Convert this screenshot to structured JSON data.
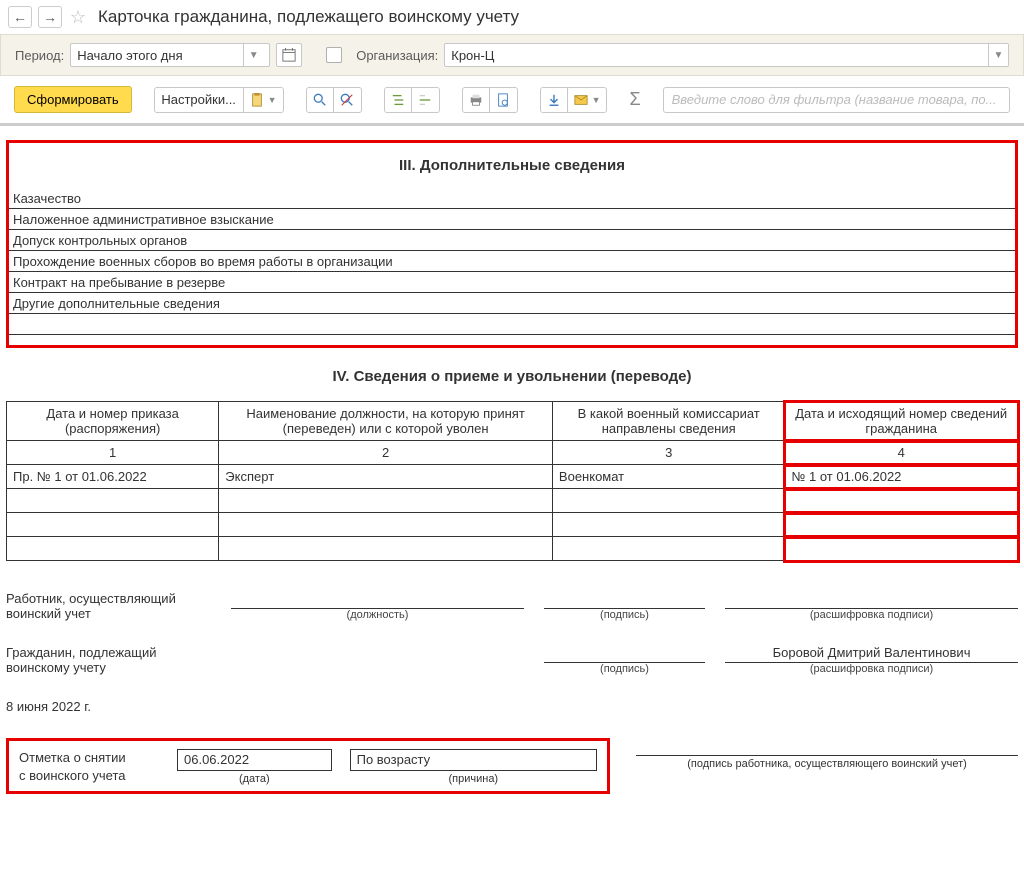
{
  "header": {
    "title": "Карточка гражданина, подлежащего воинскому учету"
  },
  "filterBar": {
    "periodLabel": "Период:",
    "periodValue": "Начало этого дня",
    "orgLabel": "Организация:",
    "orgValue": "Крон-Ц"
  },
  "toolbar": {
    "generate": "Сформировать",
    "settings": "Настройки...",
    "filterPlaceholder": "Введите слово для фильтра (название товара, по..."
  },
  "section3": {
    "title": "III. Дополнительные сведения",
    "rows": [
      "Казачество",
      "Наложенное административное взыскание",
      "Допуск контрольных органов",
      "Прохождение военных сборов во время работы в организации",
      "Контракт на пребывание в резерве",
      "Другие дополнительные сведения"
    ]
  },
  "section4": {
    "title": "IV. Сведения о приеме и увольнении (переводе)",
    "headers": {
      "c1": "Дата и номер приказа (распоряжения)",
      "c2": "Наименование должности, на которую принят (переведен) или с которой уволен",
      "c3": "В какой военный комиссариат направлены сведения",
      "c4": "Дата и исходящий номер сведений гражданина"
    },
    "colNums": {
      "n1": "1",
      "n2": "2",
      "n3": "3",
      "n4": "4"
    },
    "rows": [
      {
        "c1": "Пр. № 1 от 01.06.2022",
        "c2": "Эксперт",
        "c3": "Военкомат",
        "c4": "№ 1 от 01.06.2022"
      },
      {
        "c1": "",
        "c2": "",
        "c3": "",
        "c4": ""
      },
      {
        "c1": "",
        "c2": "",
        "c3": "",
        "c4": ""
      },
      {
        "c1": "",
        "c2": "",
        "c3": "",
        "c4": ""
      }
    ]
  },
  "signatures": {
    "worker": {
      "label": "Работник, осуществляющий воинский учет",
      "positionHint": "(должность)",
      "signHint": "(подпись)",
      "nameHint": "(расшифровка подписи)"
    },
    "citizen": {
      "label": "Гражданин, подлежащий воинскому учету",
      "signHint": "(подпись)",
      "name": "Боровой Дмитрий Валентинович",
      "nameHint": "(расшифровка подписи)"
    },
    "date": "8 июня 2022 г."
  },
  "removal": {
    "label1": "Отметка о снятии",
    "label2": "с воинского учета",
    "date": "06.06.2022",
    "dateHint": "(дата)",
    "reason": "По возрасту",
    "reasonHint": "(причина)",
    "footerSignHint": "(подпись работника, осуществляющего воинский учет)"
  }
}
